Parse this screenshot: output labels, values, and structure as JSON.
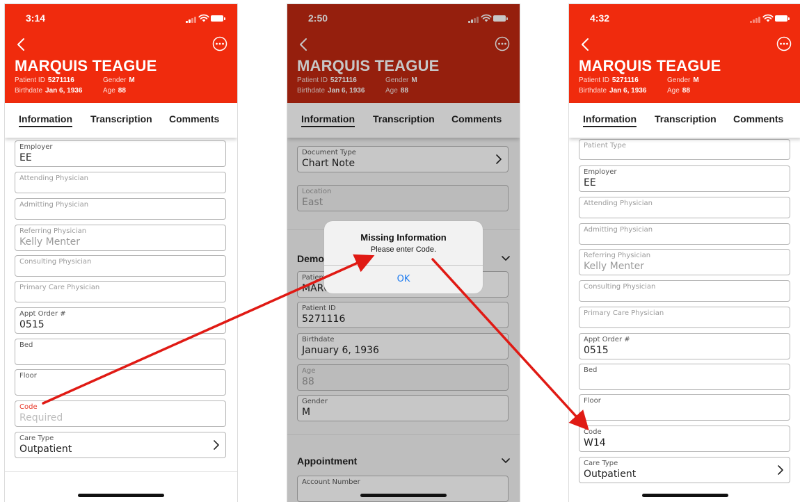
{
  "colors": {
    "header_red": "#f02b0d",
    "header_red_dimmed": "#bf2811",
    "required_red": "#e8392a",
    "alert_button_blue": "#1f7cf0",
    "annotation_arrow": "#e01a14"
  },
  "patient": {
    "name": "MARQUIS TEAGUE",
    "patient_id_label": "Patient ID",
    "patient_id": "5271116",
    "birthdate_label": "Birthdate",
    "birthdate": "Jan 6, 1936",
    "gender_label": "Gender",
    "gender": "M",
    "age_label": "Age",
    "age": "88"
  },
  "tabs": [
    "Information",
    "Transcription",
    "Comments"
  ],
  "screen1": {
    "time": "3:14",
    "fields": [
      {
        "label": "Employer",
        "value": "EE"
      },
      {
        "label": "Attending Physician",
        "value": ""
      },
      {
        "label": "Admitting Physician",
        "value": ""
      },
      {
        "label": "Referring Physician",
        "value": "Kelly Menter"
      },
      {
        "label": "Consulting Physician",
        "value": ""
      },
      {
        "label": "Primary Care Physician",
        "value": ""
      },
      {
        "label": "Appt Order #",
        "value": "0515"
      },
      {
        "label": "Bed",
        "value": ""
      },
      {
        "label": "Floor",
        "value": ""
      },
      {
        "label": "Code",
        "value": "",
        "placeholder": "Required"
      },
      {
        "label": "Care Type",
        "value": "Outpatient"
      }
    ]
  },
  "screen2": {
    "time": "2:50",
    "fields": [
      {
        "label": "Document Type",
        "value": "Chart Note"
      },
      {
        "label": "Location",
        "value": "East"
      },
      {
        "label": "Patient Name",
        "value": "MARQUIS TEAGUE"
      },
      {
        "label": "Patient ID",
        "value": "5271116"
      },
      {
        "label": "Birthdate",
        "value": "January 6, 1936"
      },
      {
        "label": "Age",
        "value": "88"
      },
      {
        "label": "Gender",
        "value": "M"
      },
      {
        "label": "Account Number",
        "value": ""
      }
    ],
    "sections": [
      "Demographics",
      "Appointment"
    ],
    "alert": {
      "title": "Missing Information",
      "message": "Please enter Code.",
      "button": "OK"
    }
  },
  "screen3": {
    "time": "4:32",
    "fields": [
      {
        "label": "Patient Type",
        "value": ""
      },
      {
        "label": "Employer",
        "value": "EE"
      },
      {
        "label": "Attending Physician",
        "value": ""
      },
      {
        "label": "Admitting Physician",
        "value": ""
      },
      {
        "label": "Referring Physician",
        "value": "Kelly Menter"
      },
      {
        "label": "Consulting Physician",
        "value": ""
      },
      {
        "label": "Primary Care Physician",
        "value": ""
      },
      {
        "label": "Appt Order #",
        "value": "0515"
      },
      {
        "label": "Bed",
        "value": ""
      },
      {
        "label": "Floor",
        "value": ""
      },
      {
        "label": "Code",
        "value": "W14"
      },
      {
        "label": "Care Type",
        "value": "Outpatient"
      }
    ]
  }
}
